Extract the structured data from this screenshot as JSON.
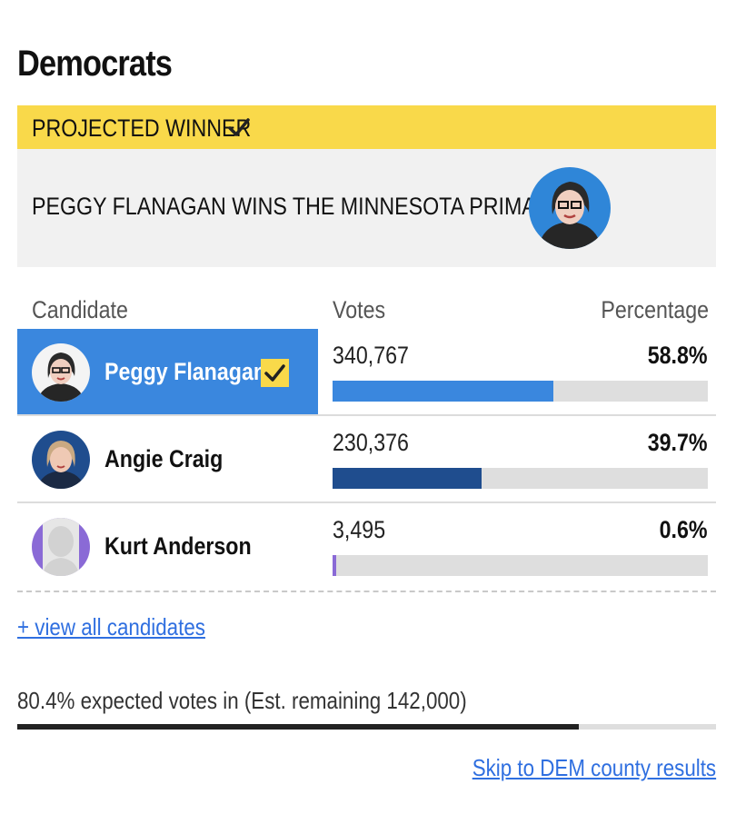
{
  "party": {
    "title": "Democrats"
  },
  "winner": {
    "banner_label": "PROJECTED WINNER",
    "headline": "PEGGY FLANAGAN WINS THE MINNESOTA PRIMARY",
    "avatar_icon": "candidate-portrait"
  },
  "table": {
    "headers": {
      "candidate": "Candidate",
      "votes": "Votes",
      "percentage": "Percentage"
    },
    "rows": [
      {
        "name": "Peggy Flanagan",
        "votes": "340,767",
        "percentage": "58.8%",
        "share": 58.8,
        "winner": true,
        "bar_color": "#3a87de"
      },
      {
        "name": "Angie Craig",
        "votes": "230,376",
        "percentage": "39.7%",
        "share": 39.7,
        "winner": false,
        "bar_color": "#1f4d8e"
      },
      {
        "name": "Kurt Anderson",
        "votes": "3,495",
        "percentage": "0.6%",
        "share": 0.6,
        "winner": false,
        "bar_color": "#8a6ad6"
      }
    ]
  },
  "links": {
    "view_all": "+ view all candidates",
    "county_results": "Skip to DEM county results"
  },
  "reporting": {
    "text": "80.4% expected votes in (Est. remaining 142,000)",
    "expected_share": 80.4
  },
  "colors": {
    "banner": "#f9d94a",
    "winner_row": "#3a87de",
    "link": "#2f6fe0"
  }
}
